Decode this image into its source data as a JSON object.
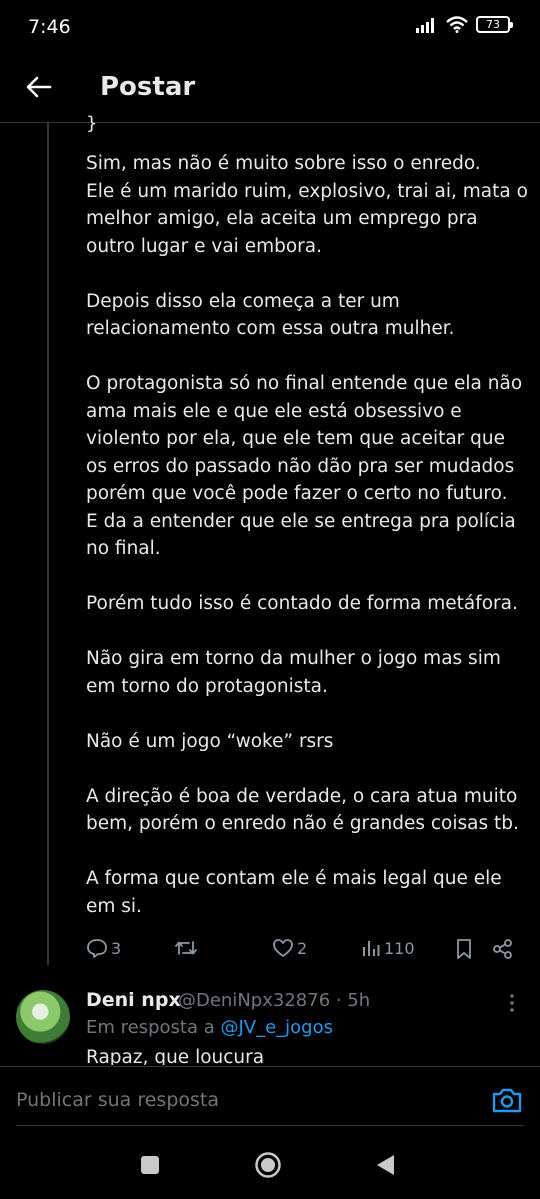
{
  "status_bar": {
    "time": "7:46",
    "battery": "73"
  },
  "header": {
    "title": "Postar"
  },
  "post": {
    "top_fragment": "}",
    "paragraphs": [
      "Sim,  mas não é muito sobre isso o enredo.\nEle é um marido ruim, explosivo, trai ai, mata o\nmelhor amigo,  ela aceita um emprego pra\noutro lugar e vai embora.",
      "Depois disso ela começa a ter um\nrelacionamento com essa outra mulher.",
      "O protagonista só no final entende que ela não\nama mais ele e que ele está obsessivo e\nviolento por ela, que ele tem que aceitar que\nos erros do passado não dão pra ser mudados\nporém que você pode fazer o certo no futuro.\nE da a entender que ele se entrega pra polícia\nno final.",
      "Porém tudo isso é contado de forma metáfora.",
      "Não gira em torno da mulher o jogo mas sim\nem torno do protagonista.",
      "Não é um jogo “woke” rsrs",
      "A direção é boa de verdade, o cara atua muito\nbem, porém o enredo não é grandes coisas tb.",
      "A forma que contam ele é mais legal que ele\nem si."
    ],
    "actions": {
      "replies": "3",
      "reposts": "",
      "likes": "2",
      "views": "110"
    }
  },
  "reply": {
    "name": "Deni npx",
    "handle": "@DeniNpx32876 · 5h",
    "in_reply_prefix": "Em resposta a ",
    "in_reply_to": "@JV_e_jogos",
    "text": "Rapaz, que loucura"
  },
  "composer": {
    "placeholder": "Publicar sua resposta"
  },
  "colors": {
    "background": "#000000",
    "text": "#e7e9ea",
    "muted": "#71767b",
    "accent": "#1d9bf0"
  }
}
